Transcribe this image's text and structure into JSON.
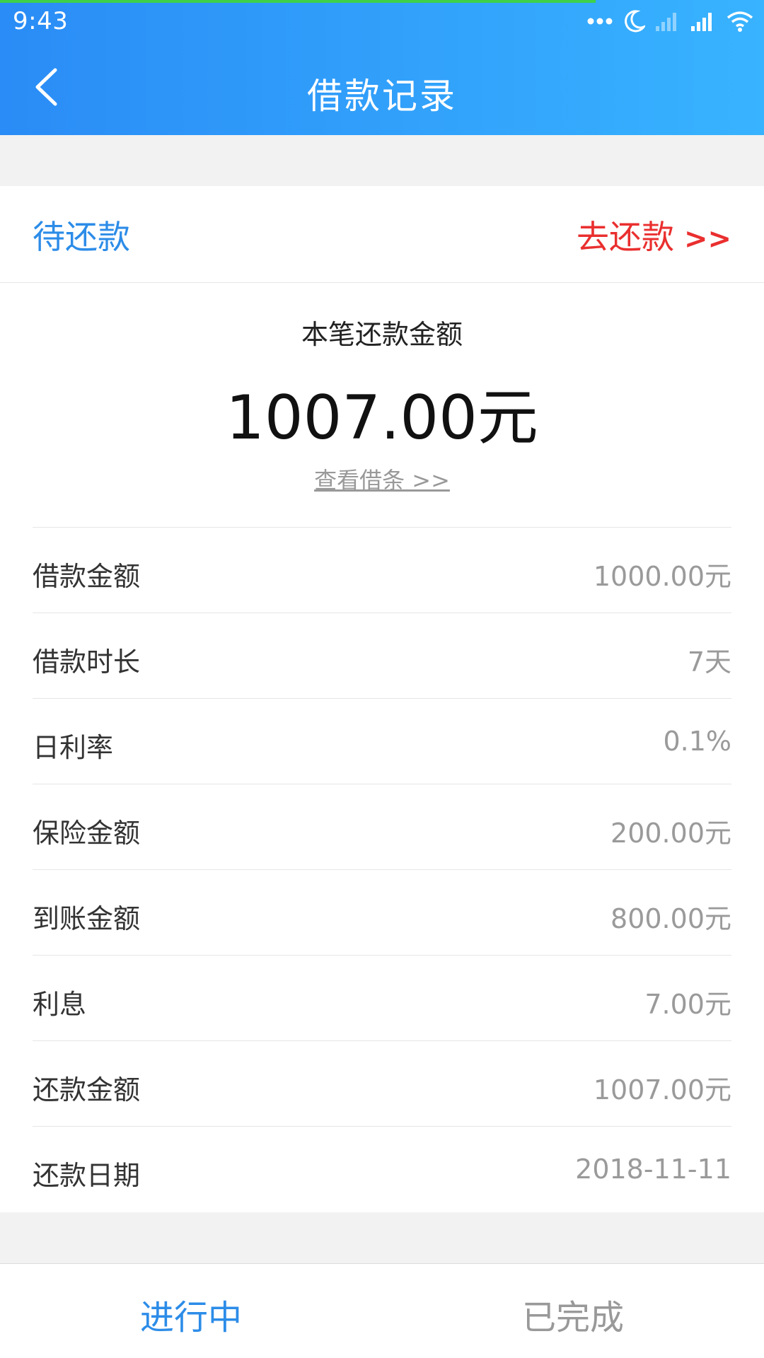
{
  "status_bar": {
    "time": "9:43",
    "icons": [
      "more-dots-icon",
      "moon-icon",
      "signal-weak-icon",
      "signal-icon",
      "wifi-icon"
    ]
  },
  "nav": {
    "title": "借款记录",
    "back_icon": "chevron-left-icon"
  },
  "colors": {
    "header_gradient_start": "#2a8cf6",
    "header_gradient_end": "#38b3ff",
    "accent_blue": "#2c8ce8",
    "accent_red": "#ea2f2f",
    "value_gray": "#9a9a9a"
  },
  "loan": {
    "status": "待还款",
    "repay_action": "去还款",
    "repay_arrows": ">>",
    "summary_label": "本笔还款金额",
    "summary_amount": "1007.00元",
    "view_note_link": "查看借条 >>"
  },
  "details": [
    {
      "label": "借款金额",
      "value": "1000.00元"
    },
    {
      "label": "借款时长",
      "value": "7天"
    },
    {
      "label": "日利率",
      "value": "0.1%"
    },
    {
      "label": "保险金额",
      "value": "200.00元"
    },
    {
      "label": "到账金额",
      "value": "800.00元"
    },
    {
      "label": "利息",
      "value": "7.00元"
    },
    {
      "label": "还款金额",
      "value": "1007.00元"
    },
    {
      "label": "还款日期",
      "value": "2018-11-11"
    }
  ],
  "tabs": [
    {
      "label": "进行中",
      "active": true
    },
    {
      "label": "已完成",
      "active": false
    }
  ]
}
